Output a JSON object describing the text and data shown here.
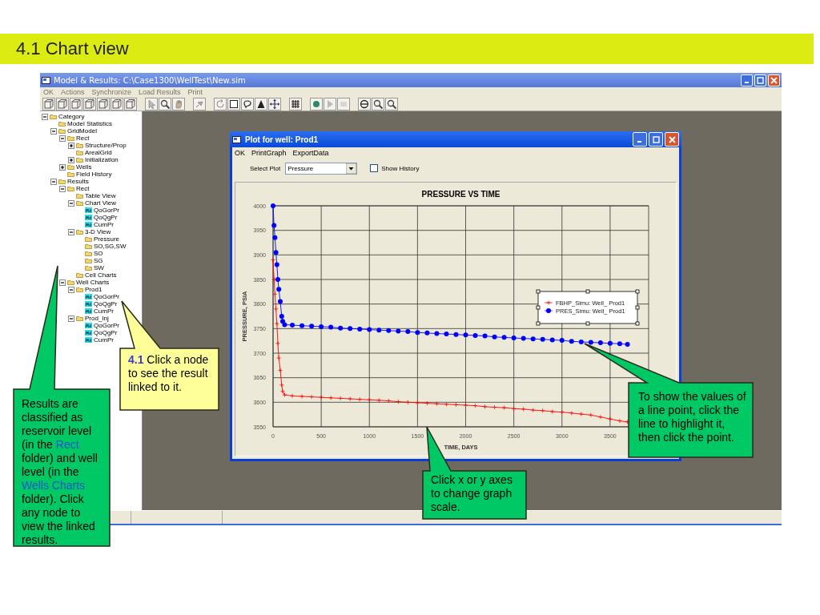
{
  "slide_title": "4.1 Chart view",
  "window": {
    "title": "Model & Results:  C:\\Case1300\\WellTest\\New.sim"
  },
  "menu": [
    {
      "label": "OK",
      "disabled": true
    },
    {
      "label": "Actions",
      "disabled": true
    },
    {
      "label": "Synchronize",
      "disabled": true
    },
    {
      "label": "Load Results",
      "disabled": true
    },
    {
      "label": "Print",
      "disabled": true
    }
  ],
  "tree": [
    {
      "label": "Category",
      "kind": "folder",
      "expanded": true,
      "children": [
        {
          "label": "Model Statistics",
          "kind": "folder"
        },
        {
          "label": "GridModel",
          "kind": "folder",
          "expanded": true,
          "children": [
            {
              "label": "Rect",
              "kind": "folder",
              "expanded": true,
              "children": [
                {
                  "label": "Structure/Prop",
                  "kind": "folder",
                  "expanded": false
                },
                {
                  "label": "ArealGrid",
                  "kind": "folder"
                },
                {
                  "label": "Initialization",
                  "kind": "folder",
                  "expanded": false
                }
              ]
            },
            {
              "label": "Wells",
              "kind": "folder",
              "expanded": false
            },
            {
              "label": "Field History",
              "kind": "folder"
            }
          ]
        },
        {
          "label": "Results",
          "kind": "folder",
          "expanded": true,
          "children": [
            {
              "label": "Rect",
              "kind": "folder",
              "expanded": true,
              "children": [
                {
                  "label": "Table View",
                  "kind": "folder"
                },
                {
                  "label": "Chart View",
                  "kind": "folder",
                  "expanded": true,
                  "children": [
                    {
                      "label": "QoGorPr",
                      "kind": "chart"
                    },
                    {
                      "label": "QoQgPr",
                      "kind": "chart"
                    },
                    {
                      "label": "CumPr",
                      "kind": "chart"
                    }
                  ]
                },
                {
                  "label": "3-D View",
                  "kind": "folder",
                  "expanded": true,
                  "children": [
                    {
                      "label": "Pressure",
                      "kind": "folder"
                    },
                    {
                      "label": "SO,SG,SW",
                      "kind": "folder"
                    },
                    {
                      "label": "SO",
                      "kind": "folder"
                    },
                    {
                      "label": "SG",
                      "kind": "folder"
                    },
                    {
                      "label": "SW",
                      "kind": "folder"
                    }
                  ]
                },
                {
                  "label": "Cell Charts",
                  "kind": "folder"
                }
              ]
            },
            {
              "label": "Well Charts",
              "kind": "folder",
              "expanded": true,
              "children": [
                {
                  "label": "Prod1",
                  "kind": "folder",
                  "expanded": true,
                  "children": [
                    {
                      "label": "QoGorPr",
                      "kind": "chart"
                    },
                    {
                      "label": "QoQgPr",
                      "kind": "chart"
                    },
                    {
                      "label": "CumPr",
                      "kind": "chart"
                    }
                  ]
                },
                {
                  "label": "Prod_Inj",
                  "kind": "folder",
                  "expanded": true,
                  "children": [
                    {
                      "label": "QoGorPr",
                      "kind": "chart"
                    },
                    {
                      "label": "QoQgPr",
                      "kind": "chart"
                    },
                    {
                      "label": "CumPr",
                      "kind": "chart"
                    }
                  ]
                }
              ]
            }
          ]
        }
      ]
    }
  ],
  "plot_window": {
    "title": "Plot for well: Prod1",
    "menu": [
      {
        "label": "OK",
        "disabled": false
      },
      {
        "label": "PrintGraph",
        "disabled": false
      },
      {
        "label": "ExportData",
        "disabled": false
      }
    ],
    "select_plot": {
      "label": "Select Plot",
      "value": "Pressure"
    },
    "show_history": {
      "label": "Show History",
      "checked": false
    },
    "chart_data": {
      "type": "line",
      "title": "PRESSURE VS TIME",
      "xlabel": "TIME, DAYS",
      "ylabel": "PRESSURE, PSIA",
      "x": [
        0,
        10,
        20,
        30,
        40,
        50,
        60,
        75,
        90,
        100,
        120,
        200,
        300,
        400,
        500,
        600,
        700,
        800,
        900,
        1000,
        1100,
        1200,
        1300,
        1400,
        1500,
        1600,
        1700,
        1800,
        1900,
        2000,
        2100,
        2200,
        2300,
        2400,
        2500,
        2600,
        2700,
        2800,
        2900,
        3000,
        3100,
        3200,
        3300,
        3400,
        3500,
        3600,
        3680
      ],
      "series": [
        {
          "name": "FBHP_Simu: Well_ Prod1",
          "color": "#ff0000",
          "marker": "cross",
          "values": [
            3890,
            3850,
            3820,
            3790,
            3760,
            3720,
            3690,
            3665,
            3635,
            3622,
            3615,
            3613,
            3612,
            3611,
            3610,
            3609,
            3608,
            3607,
            3606,
            3605,
            3604,
            3603,
            3601,
            3600,
            3599,
            3598,
            3597,
            3596,
            3595,
            3594,
            3593,
            3591,
            3590,
            3589,
            3587,
            3586,
            3584,
            3583,
            3581,
            3580,
            3578,
            3576,
            3574,
            3570,
            3566,
            3562,
            3560
          ]
        },
        {
          "name": "PRES_Simu: Well_ Prod1",
          "color": "#0000ff",
          "marker": "circle",
          "values": [
            4000,
            3960,
            3935,
            3905,
            3880,
            3850,
            3830,
            3805,
            3775,
            3765,
            3758,
            3757,
            3756,
            3755,
            3754,
            3753,
            3751,
            3750,
            3749,
            3748,
            3747,
            3746,
            3745,
            3744,
            3742,
            3741,
            3740,
            3739,
            3738,
            3737,
            3736,
            3735,
            3733,
            3732,
            3731,
            3730,
            3729,
            3728,
            3727,
            3726,
            3724,
            3723,
            3722,
            3721,
            3720,
            3719,
            3718
          ]
        }
      ],
      "grid": true,
      "legend": true,
      "xlim": [
        0,
        3900
      ],
      "ylim": [
        3550,
        4000
      ],
      "xticks": [
        0,
        500,
        1000,
        1500,
        2000,
        2500,
        3000,
        3500
      ],
      "yticks": [
        3550,
        3600,
        3650,
        3700,
        3750,
        3800,
        3850,
        3900,
        3950,
        4000
      ]
    }
  },
  "callouts": [
    {
      "kind": "green",
      "runs": [
        {
          "kind": "plain",
          "text": "Results are classified as reservoir level (in the "
        },
        {
          "kind": "term",
          "text": "Rect"
        },
        {
          "kind": "plain",
          "text": " folder) and well level (in the "
        },
        {
          "kind": "term",
          "text": "Wells Charts"
        },
        {
          "kind": "plain",
          "text": " folder). Click any node to view the linked results."
        }
      ]
    },
    {
      "kind": "yellow",
      "runs": [
        {
          "kind": "number",
          "text": "4.1"
        },
        {
          "kind": "plain",
          "text": " Click a node to see the result linked to it."
        }
      ]
    },
    {
      "kind": "green",
      "runs": [
        {
          "kind": "plain",
          "text": "To show the values of a line point, click the line to highlight it, then click the point."
        }
      ]
    },
    {
      "kind": "green",
      "runs": [
        {
          "kind": "plain",
          "text": "Click x or y axes to change graph scale."
        }
      ]
    }
  ]
}
